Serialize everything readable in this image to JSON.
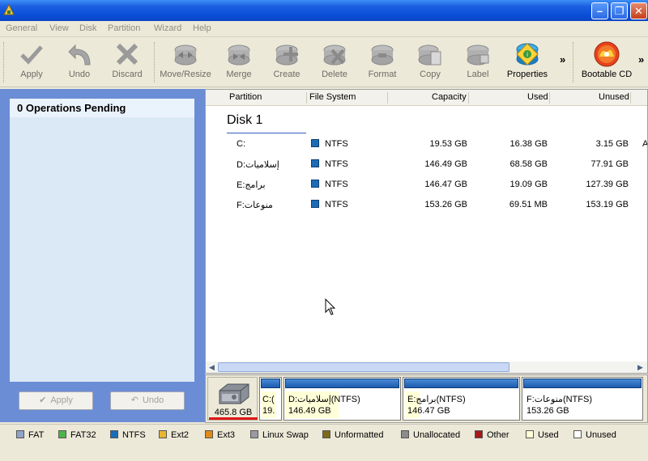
{
  "menu": [
    "General",
    "View",
    "Disk",
    "Partition",
    "Wizard",
    "Help"
  ],
  "toolbar": {
    "apply": "Apply",
    "undo": "Undo",
    "discard": "Discard",
    "move_resize": "Move/Resize",
    "merge": "Merge",
    "create": "Create",
    "delete": "Delete",
    "format": "Format",
    "copy": "Copy",
    "label": "Label",
    "properties": "Properties",
    "bootable_cd": "Bootable CD",
    "more": "»"
  },
  "left_panel": {
    "header": "0 Operations Pending",
    "apply_button": "Apply",
    "undo_button": "Undo"
  },
  "grid": {
    "columns": [
      "Partition",
      "File System",
      "Capacity",
      "Used",
      "Unused"
    ],
    "disk_name": "Disk 1",
    "rows": [
      {
        "partition": "C:",
        "fs": "NTFS",
        "capacity": "19.53 GB",
        "used": "16.38 GB",
        "unused": "3.15 GB",
        "extra": "A"
      },
      {
        "partition": "D:إسلاميات",
        "fs": "NTFS",
        "capacity": "146.49 GB",
        "used": "68.58 GB",
        "unused": "77.91 GB",
        "extra": ""
      },
      {
        "partition": "E:برامج",
        "fs": "NTFS",
        "capacity": "146.47 GB",
        "used": "19.09 GB",
        "unused": "127.39 GB",
        "extra": ""
      },
      {
        "partition": "F:منوعات",
        "fs": "NTFS",
        "capacity": "153.26 GB",
        "used": "69.51 MB",
        "unused": "153.19 GB",
        "extra": ""
      }
    ]
  },
  "disk_map": {
    "disk_size": "465.8 GB",
    "blocks": [
      {
        "line1": "C:(",
        "line2": "19.",
        "used_fraction": 0.84
      },
      {
        "line1": "D:إسلاميات(NTFS)",
        "line2": "146.49 GB",
        "used_fraction": 0.47
      },
      {
        "line1": "E:برامج(NTFS)",
        "line2": "146.47 GB",
        "used_fraction": 0.13
      },
      {
        "line1": "F:منوعات(NTFS)",
        "line2": "153.26 GB",
        "used_fraction": 0.0
      }
    ]
  },
  "legend": [
    {
      "label": "FAT",
      "color": "#8fa3c9"
    },
    {
      "label": "FAT32",
      "color": "#4bb54b"
    },
    {
      "label": "NTFS",
      "color": "#1b6cb7"
    },
    {
      "label": "Ext2",
      "color": "#e8b530"
    },
    {
      "label": "Ext3",
      "color": "#e08a1a"
    },
    {
      "label": "Linux Swap",
      "color": "#9a9aa4"
    },
    {
      "label": "Unformatted",
      "color": "#7e6a1a"
    },
    {
      "label": "Unallocated",
      "color": "#8c8c8c"
    },
    {
      "label": "Other",
      "color": "#a81818"
    },
    {
      "label": "Used",
      "color": "#ffffd8"
    },
    {
      "label": "Unused",
      "color": "#ffffff"
    }
  ]
}
